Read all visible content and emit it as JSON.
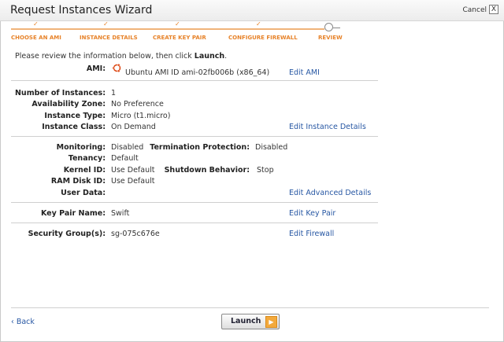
{
  "window": {
    "title": "Request Instances Wizard",
    "cancel_label": "Cancel",
    "close_glyph": "X"
  },
  "steps": [
    {
      "label": "CHOOSE AN AMI",
      "check": "✓"
    },
    {
      "label": "INSTANCE DETAILS",
      "check": "✓"
    },
    {
      "label": "CREATE KEY PAIR",
      "check": "✓"
    },
    {
      "label": "CONFIGURE FIREWALL",
      "check": "✓"
    },
    {
      "label": "REVIEW"
    }
  ],
  "intro": {
    "prefix": "Please review the information below, then click ",
    "action": "Launch",
    "suffix": "."
  },
  "ami": {
    "label": "AMI:",
    "value": "Ubuntu AMI ID ami-02fb006b (x86_64)",
    "edit": "Edit AMI",
    "icon": "ubuntu-icon"
  },
  "details": {
    "count_label": "Number of Instances:",
    "count_value": "1",
    "zone_label": "Availability Zone:",
    "zone_value": "No Preference",
    "type_label": "Instance Type:",
    "type_value": "Micro (t1.micro)",
    "class_label": "Instance Class:",
    "class_value": "On Demand",
    "edit": "Edit Instance Details"
  },
  "advanced": {
    "monitoring_label": "Monitoring:",
    "monitoring_value": "Disabled",
    "termination_label": "Termination Protection:",
    "termination_value": "Disabled",
    "tenancy_label": "Tenancy:",
    "tenancy_value": "Default",
    "kernel_label": "Kernel ID:",
    "kernel_value": "Use Default",
    "shutdown_label": "Shutdown Behavior:",
    "shutdown_value": "Stop",
    "ramdisk_label": "RAM Disk ID:",
    "ramdisk_value": "Use Default",
    "userdata_label": "User Data:",
    "edit": "Edit Advanced Details"
  },
  "keypair": {
    "label": "Key Pair Name:",
    "value": "Swift",
    "edit": "Edit Key Pair"
  },
  "security": {
    "label": "Security Group(s):",
    "value": "sg-075c676e",
    "edit": "Edit Firewall"
  },
  "footer": {
    "back_label": "‹ Back",
    "launch_label": "Launch",
    "launch_glyph": "▶"
  },
  "colors": {
    "accent": "#e7832a",
    "link": "#2757a3"
  }
}
